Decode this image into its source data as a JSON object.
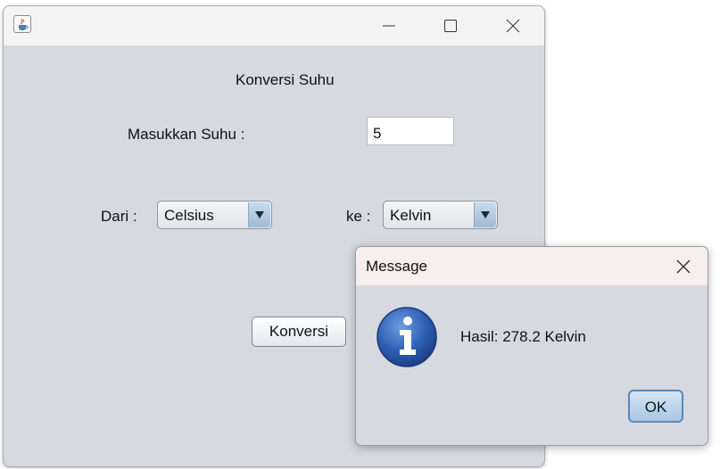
{
  "main_window": {
    "title": "",
    "heading": "Konversi Suhu",
    "temperature_label": "Masukkan Suhu :",
    "temperature_value": "5",
    "from_label": "Dari :",
    "from_selected": "Celsius",
    "to_label": "ke :",
    "to_selected": "Kelvin",
    "convert_button": "Konversi"
  },
  "dialog": {
    "title": "Message",
    "message": "Hasil: 278.2 Kelvin",
    "ok_button": "OK",
    "icon": "information-icon"
  },
  "colors": {
    "window_background": "#d6d9e0",
    "dialog_titlebar": "#f7eeee",
    "info_icon_blue": "#2f5fb3",
    "ok_button_border": "#5b88b8"
  }
}
